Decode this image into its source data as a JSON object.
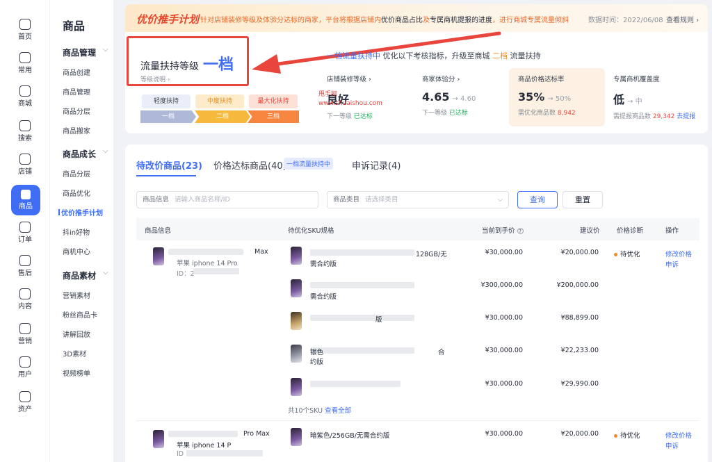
{
  "rail": [
    {
      "label": "首页",
      "icon": "home-icon"
    },
    {
      "label": "常用",
      "icon": "folder-icon"
    },
    {
      "label": "商城",
      "icon": "store-icon"
    },
    {
      "label": "搜索",
      "icon": "search-icon"
    },
    {
      "label": "店铺",
      "icon": "shop-icon"
    },
    {
      "label": "商品",
      "icon": "bag-icon"
    },
    {
      "label": "订单",
      "icon": "order-icon"
    },
    {
      "label": "售后",
      "icon": "after-sale-icon"
    },
    {
      "label": "内容",
      "icon": "tv-icon"
    },
    {
      "label": "营销",
      "icon": "megaphone-icon"
    },
    {
      "label": "用户",
      "icon": "user-icon"
    },
    {
      "label": "资产",
      "icon": "wallet-icon"
    }
  ],
  "subnav": {
    "title": "商品",
    "sections": [
      {
        "label": "商品管理",
        "items": [
          "商品创建",
          "商品管理",
          "商品分层",
          "商品搬家"
        ]
      },
      {
        "label": "商品成长",
        "items": [
          "商品分层",
          "商品优化",
          "优价推手计划",
          "抖in好物",
          "商机中心"
        ]
      },
      {
        "label": "商品素材",
        "items": [
          "营销素材",
          "粉丝商品卡",
          "讲解回放",
          "3D素材",
          "视频榜单"
        ]
      }
    ]
  },
  "banner": {
    "title": "优价推手计划",
    "desc_1": "针对店铺装修等级及体验分达标的商家，平台将根据店铺内",
    "desc_2": "优价商品占比",
    "desc_3": "及",
    "desc_4": "专属商机提报的进度",
    "desc_5": "，进行商城专属流量倾斜",
    "date": "数据时间：2022/06/08",
    "rule": "查看规则 ›"
  },
  "level": {
    "name": "流量扶持等级",
    "value": "一档",
    "help": "等级说明 ›",
    "tags": [
      "轻度扶持",
      "中度扶持",
      "最大化扶持"
    ],
    "steps": [
      "一档",
      "二档",
      "三档"
    ]
  },
  "current": {
    "a": "一档流量扶持中",
    "b": "优化以下考核指标，升级至商城",
    "c": "二档",
    "d": "流量扶持"
  },
  "metrics": [
    {
      "title": "店铺装修等级 ›",
      "value": "良好",
      "next": "",
      "sub_a": "下一等级 ",
      "sub_b": "已达标",
      "sub_c": ""
    },
    {
      "title": "商家体验分 ›",
      "value": "4.65",
      "next": "→ 4.60",
      "sub_a": "下一等级 ",
      "sub_b": "已达标",
      "sub_c": ""
    },
    {
      "title": "商品价格达标率",
      "value": "35%",
      "next": "→ 50%",
      "sub_a": "需优化商品数 ",
      "sub_b": "8,942",
      "sub_c": ""
    },
    {
      "title": "专属商机覆盖度",
      "value": "低",
      "next": "→ 中",
      "sub_a": "需提报商品数 ",
      "sub_b": "29,342",
      "sub_c": "去提报"
    }
  ],
  "watermark": {
    "a": "甩手网",
    "b": "www.shuaishou.com"
  },
  "tabs": [
    {
      "label": "待改价商品(23)"
    },
    {
      "label": "价格达标商品(40)"
    },
    {
      "label": "申诉记录(4)"
    }
  ],
  "tab_badge": "一档流量扶持中",
  "filters": {
    "info_label": "商品信息",
    "info_placeholder": "请输入商品名称/ID",
    "cat_label": "商品类目",
    "cat_placeholder": "请选择类目",
    "query": "查询",
    "reset": "重置"
  },
  "table": {
    "headers": [
      "商品信息",
      "待优化SKU规格",
      "当前到手价",
      "建议价",
      "价格诊断",
      "操作"
    ],
    "rows": [
      {
        "product_a": "Max",
        "product_b": "苹果 iphone 14 Pro",
        "product_id": "ID：2"
      },
      {
        "product_a": "Pro Max",
        "product_b": "苹果 iphone 14 P",
        "product_id": "ID"
      }
    ],
    "skus": [
      {
        "spec": "128GB/无",
        "spec2": "需合约版",
        "price": "¥30,000.00",
        "suggest": "¥20,000.00"
      },
      {
        "spec": "",
        "spec2": "需合约版",
        "price": "¥300,000.00",
        "suggest": "¥200,000.00"
      },
      {
        "spec": "版",
        "spec2": "",
        "price": "¥30,000.00",
        "suggest": "¥88,899.00"
      },
      {
        "spec": "银色",
        "spec2": "约版",
        "spec3": "合",
        "price": "¥30,000.00",
        "suggest": "¥22,233.00"
      },
      {
        "spec": "",
        "spec2": "",
        "price": "¥30,000.00",
        "suggest": "¥29,990.00"
      }
    ],
    "sku_more_a": "共10个SKU",
    "sku_more_b": "查看全部",
    "row2_sku": "暗紫色/256GB/无需合约版",
    "row2_price": "¥30,000.00",
    "row2_suggest": "¥20,000.00",
    "status": "待优化",
    "action_a": "修改价格",
    "action_b": "申诉"
  }
}
